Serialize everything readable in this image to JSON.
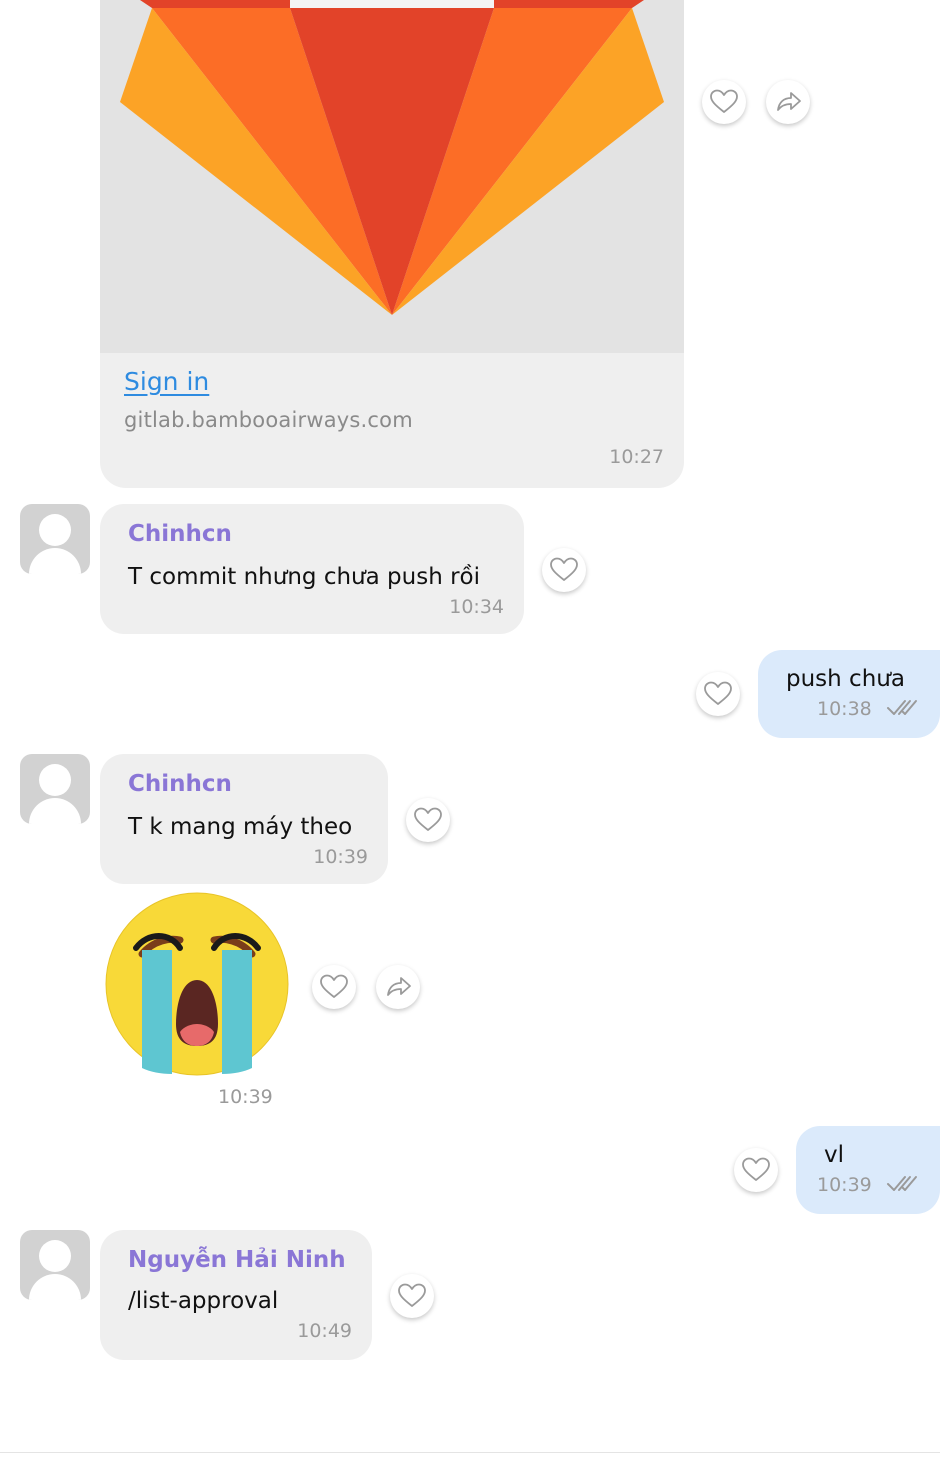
{
  "link_preview": {
    "link_text": "Sign in",
    "domain": "gitlab.bambooairways.com",
    "time": "10:27"
  },
  "messages": [
    {
      "sender": "Chinhcn",
      "text": "T commit nhưng chưa push rồi",
      "time": "10:34"
    },
    {
      "text": "push chưa",
      "time": "10:38"
    },
    {
      "sender": "Chinhcn",
      "text": "T k mang máy theo",
      "time": "10:39"
    },
    {
      "sticker": "crying-face",
      "time": "10:39"
    },
    {
      "text": "vl",
      "time": "10:39"
    },
    {
      "sender": "Nguyễn Hải Ninh",
      "text": "/list-approval",
      "time": "10:49"
    }
  ],
  "colors": {
    "incoming_bubble": "#efefef",
    "outgoing_bubble": "#dbeafb",
    "sender_name": "#8a76d6",
    "link": "#2e8be0"
  },
  "icons": [
    "heart-icon",
    "share-icon",
    "double-check-icon",
    "avatar-placeholder-icon"
  ]
}
